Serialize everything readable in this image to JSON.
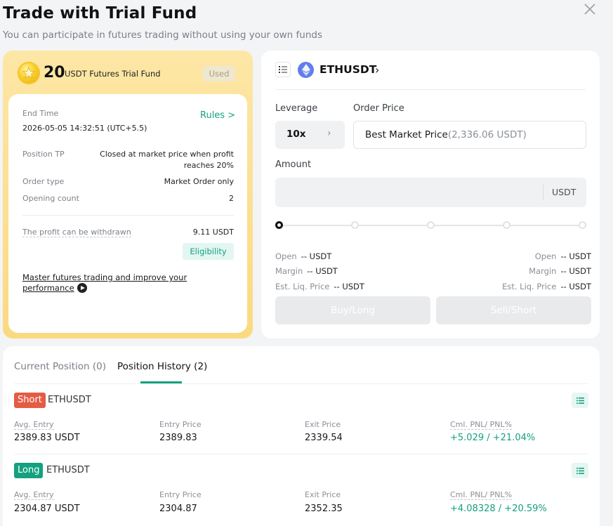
{
  "header": {
    "title": "Trade with Trial Fund",
    "subtitle": "You can participate in futures trading without using your own funds"
  },
  "fund": {
    "amount": "20",
    "label": "USDT Futures Trial Fund",
    "status": "Used",
    "end_time_label": "End Time",
    "end_time_value": "2026-05-05 14:32:51 (UTC+5.5)",
    "rules_label": "Rules >",
    "position_tp_label": "Position TP",
    "position_tp_line1": "Closed at market price when profit",
    "position_tp_line2": "reaches 20%",
    "order_type_label": "Order type",
    "order_type_value": "Market Order only",
    "opening_count_label": "Opening count",
    "opening_count_value": "2",
    "profit_label": "The profit can be withdrawn",
    "profit_value": "9.11 USDT",
    "eligibility_label": "Eligibility",
    "master_line1": "Master futures trading and improve your",
    "master_line2": "performance"
  },
  "trade": {
    "symbol": "ETHUSDT",
    "leverage_label": "Leverage",
    "leverage_value": "10x",
    "order_price_label": "Order Price",
    "order_price_main": "Best Market Price",
    "order_price_sub": "(2,336.06 USDT)",
    "amount_label": "Amount",
    "amount_unit": "USDT",
    "slider_level": 0,
    "left_info": {
      "open_label": "Open",
      "open_value": "-- USDT",
      "margin_label": "Margin",
      "margin_value": "-- USDT",
      "liq_label": "Est. Liq. Price",
      "liq_value": "-- USDT"
    },
    "right_info": {
      "open_label": "Open",
      "open_value": "-- USDT",
      "margin_label": "Margin",
      "margin_value": "-- USDT",
      "liq_label": "Est. Liq. Price",
      "liq_value": "-- USDT"
    },
    "buy_label": "Buy/Long",
    "sell_label": "Sell/Short"
  },
  "history": {
    "tabs": [
      {
        "label": "Current Position (0)"
      },
      {
        "label": "Position History (2)"
      }
    ],
    "columns": [
      "Avg. Entry",
      "Entry Price",
      "Exit Price",
      "Cml. PNL/ PNL%"
    ],
    "positions": [
      {
        "side": "Short",
        "symbol": "ETHUSDT",
        "avg_entry": "2389.83 USDT",
        "entry_price": "2389.83",
        "exit_price": "2339.54",
        "pnl": "+5.029 / +21.04%"
      },
      {
        "side": "Long",
        "symbol": "ETHUSDT",
        "avg_entry": "2304.87 USDT",
        "entry_price": "2304.87",
        "exit_price": "2352.35",
        "pnl": "+4.08328 / +20.59%"
      }
    ]
  },
  "colors": {
    "accent": "#14a17f",
    "short": "#e45c43",
    "long": "#14a17f",
    "eth": "#627eea"
  }
}
